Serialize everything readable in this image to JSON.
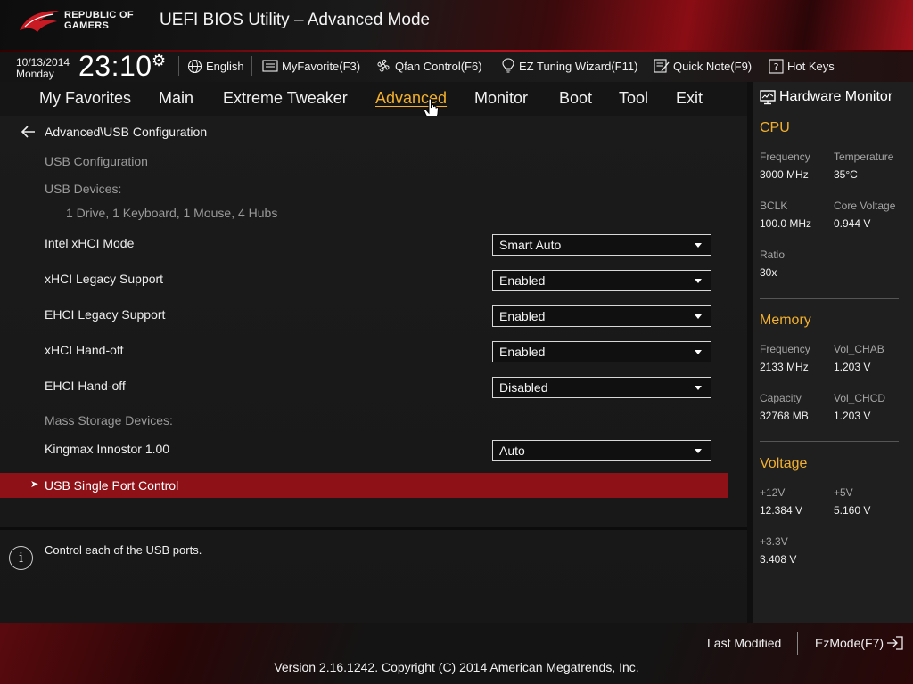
{
  "header": {
    "brand_line1": "REPUBLIC OF",
    "brand_line2": "GAMERS",
    "title": "UEFI BIOS Utility – Advanced Mode"
  },
  "status": {
    "date": "10/13/2014",
    "day": "Monday",
    "time": "23:10",
    "language": "English",
    "myfavorite": "MyFavorite(F3)",
    "qfan": "Qfan Control(F6)",
    "ez_tuning": "EZ Tuning Wizard(F11)",
    "quick_note": "Quick Note(F9)",
    "hot_keys": "Hot Keys"
  },
  "tabs": [
    {
      "label": "My Favorites"
    },
    {
      "label": "Main"
    },
    {
      "label": "Extreme Tweaker"
    },
    {
      "label": "Advanced",
      "active": true
    },
    {
      "label": "Monitor"
    },
    {
      "label": "Boot"
    },
    {
      "label": "Tool"
    },
    {
      "label": "Exit"
    }
  ],
  "main": {
    "breadcrumb": "Advanced\\USB Configuration",
    "section_title": "USB Configuration",
    "usb_devices_label": "USB Devices:",
    "usb_devices_value": "1 Drive, 1 Keyboard, 1 Mouse, 4 Hubs",
    "settings": [
      {
        "label": "Intel xHCI Mode",
        "value": "Smart Auto"
      },
      {
        "label": "xHCI Legacy Support",
        "value": "Enabled"
      },
      {
        "label": "EHCI Legacy Support",
        "value": "Enabled"
      },
      {
        "label": "xHCI Hand-off",
        "value": "Enabled"
      },
      {
        "label": "EHCI Hand-off",
        "value": "Disabled"
      }
    ],
    "mass_storage_label": "Mass Storage Devices:",
    "mass_storage_device": {
      "label": "Kingmax Innostor 1.00",
      "value": "Auto"
    },
    "submenu": "USB Single Port Control",
    "help_text": "Control each of the USB ports."
  },
  "monitor": {
    "title": "Hardware Monitor",
    "cpu": {
      "heading": "CPU",
      "frequency_label": "Frequency",
      "frequency": "3000 MHz",
      "temperature_label": "Temperature",
      "temperature": "35°C",
      "bclk_label": "BCLK",
      "bclk": "100.0 MHz",
      "core_voltage_label": "Core Voltage",
      "core_voltage": "0.944 V",
      "ratio_label": "Ratio",
      "ratio": "30x"
    },
    "memory": {
      "heading": "Memory",
      "frequency_label": "Frequency",
      "frequency": "2133 MHz",
      "vol_chab_label": "Vol_CHAB",
      "vol_chab": "1.203 V",
      "capacity_label": "Capacity",
      "capacity": "32768 MB",
      "vol_chcd_label": "Vol_CHCD",
      "vol_chcd": "1.203 V"
    },
    "voltage": {
      "heading": "Voltage",
      "v12_label": "+12V",
      "v12": "12.384 V",
      "v5_label": "+5V",
      "v5": "5.160 V",
      "v33_label": "+3.3V",
      "v33": "3.408 V"
    }
  },
  "footer": {
    "last_modified": "Last Modified",
    "ez_mode": "EzMode(F7)",
    "copyright": "Version 2.16.1242. Copyright (C) 2014 American Megatrends, Inc."
  },
  "colors": {
    "accent_orange": "#f2b02c",
    "highlight_red": "#8e1117"
  }
}
